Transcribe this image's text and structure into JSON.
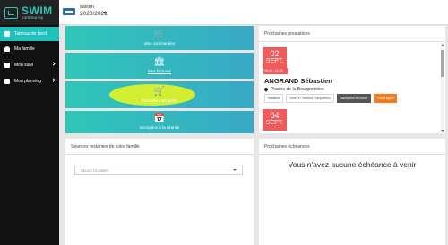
{
  "header": {
    "logo_text": "SWIM",
    "logo_subtext": "community",
    "season_label": "saison",
    "season_value": "2020/2021"
  },
  "sidebar": {
    "items": [
      {
        "label": "Tableau de bord",
        "icon": "dashboard-icon",
        "active": true
      },
      {
        "label": "Ma famille",
        "icon": "people-icon",
        "active": false
      },
      {
        "label": "Mon suivi",
        "icon": "chart-icon",
        "active": false,
        "has_submenu": true
      },
      {
        "label": "Mon planning",
        "icon": "calendar-icon",
        "active": false,
        "has_submenu": true
      }
    ]
  },
  "tiles": {
    "orders": {
      "label": "Mes commandes",
      "icon": "cart-icon"
    },
    "bills": {
      "label": "Mes factures",
      "icon": "bank-icon"
    },
    "new_registration": {
      "label": "Nouvelle inscription",
      "icon": "cart-plus-icon"
    },
    "session_registration": {
      "label": "Inscription à la séance",
      "icon": "calendar-icon"
    }
  },
  "upcoming_services": {
    "title": "Prochaines prestations",
    "item": {
      "day": "02",
      "month": "SEPT.",
      "time": "19:40 - 21:00",
      "name": "ANGRAND Sébastien",
      "location": "Piscine de la Bourgonnière",
      "tags": [
        "Natation",
        "Juniors / Seniors Compétition",
        "Inscription en cours",
        "Pas d'appel"
      ]
    },
    "next_item": {
      "day": "04",
      "month": "SEPT."
    }
  },
  "family_sessions": {
    "title": "Séances restantes de votre famille",
    "select_placeholder": "SÉLECTIONNER"
  },
  "upcoming_deadlines": {
    "title": "Prochaines échéances",
    "empty_message": "Vous n'avez aucune échéance à venir"
  },
  "colors": {
    "accent": "#20c0bc",
    "tile_gradient_start": "#2fc6b8",
    "tile_gradient_end": "#38a9c6",
    "date_badge": "#f05a5a",
    "tag_orange": "#f47a1f",
    "highlight": "#dcf12a",
    "sidebar_bg": "#111111"
  }
}
